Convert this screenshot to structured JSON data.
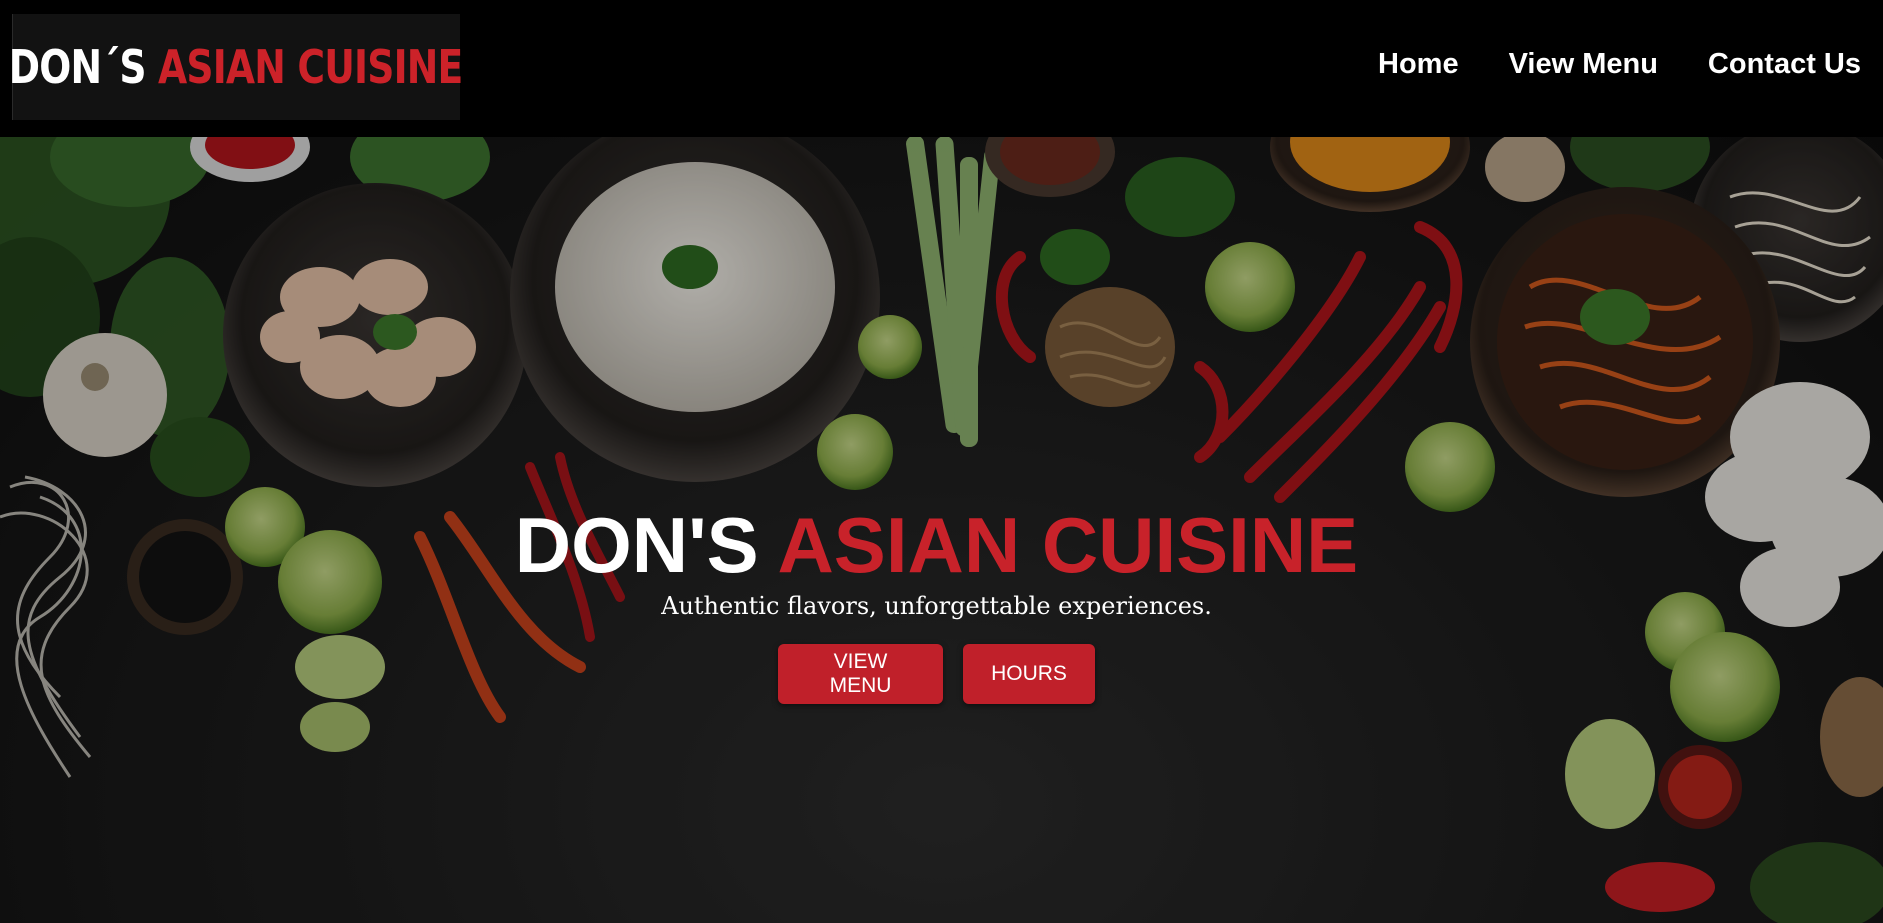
{
  "header": {
    "logo": {
      "part1": "DON´S",
      "part2": "ASIAN CUISINE"
    },
    "nav": [
      {
        "label": "Home"
      },
      {
        "label": "View Menu"
      },
      {
        "label": "Contact Us"
      }
    ]
  },
  "hero": {
    "title_part1": "DON'S",
    "title_part2": "ASIAN CUISINE",
    "tagline": "Authentic flavors, unforgettable experiences.",
    "buttons": {
      "view_menu": "VIEW MENU",
      "hours": "HOURS"
    }
  },
  "colors": {
    "brand_red": "#c8222a",
    "header_bg": "#000000",
    "text": "#ffffff"
  }
}
